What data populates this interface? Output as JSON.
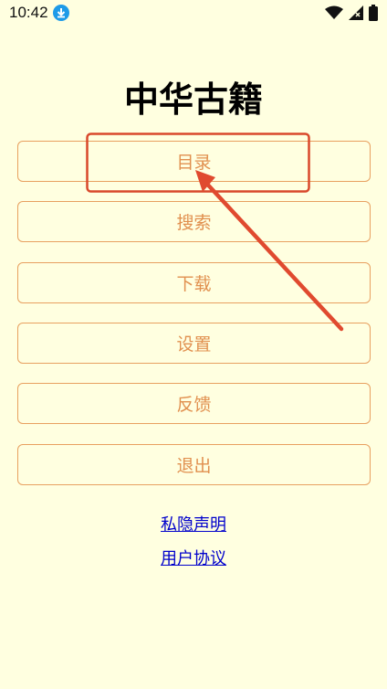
{
  "statusbar": {
    "time": "10:42",
    "icons": [
      "download-icon",
      "wifi-icon",
      "signal-icon",
      "battery-icon"
    ]
  },
  "app": {
    "title": "中华古籍"
  },
  "menu": {
    "items": [
      {
        "label": "目录"
      },
      {
        "label": "搜索"
      },
      {
        "label": "下载"
      },
      {
        "label": "设置"
      },
      {
        "label": "反馈"
      },
      {
        "label": "退出"
      }
    ]
  },
  "links": {
    "privacy": "私隐声明",
    "agreement": "用户协议"
  },
  "colors": {
    "background": "#ffffe0",
    "button_border": "#e8a060",
    "button_text": "#e1904f",
    "link": "#0000cc",
    "annotation": "#d9482b"
  }
}
